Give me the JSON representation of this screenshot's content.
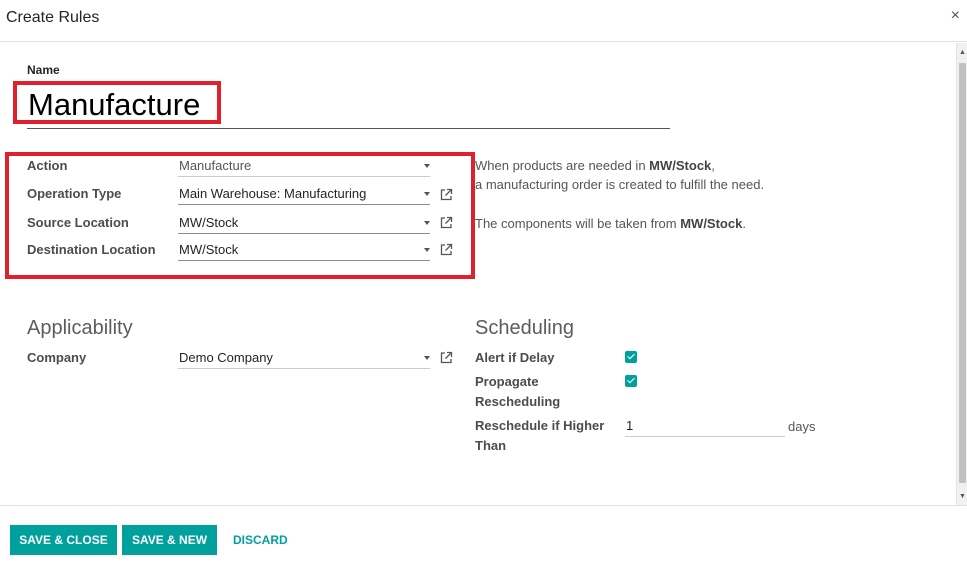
{
  "dialog": {
    "title": "Create Rules",
    "close_label": "×"
  },
  "name": {
    "label": "Name",
    "value": "Manufacture"
  },
  "fields": {
    "action": {
      "label": "Action",
      "value": "Manufacture"
    },
    "operation_type": {
      "label": "Operation Type",
      "value": "Main Warehouse: Manufacturing"
    },
    "source_location": {
      "label": "Source Location",
      "value": "MW/Stock"
    },
    "destination_location": {
      "label": "Destination Location",
      "value": "MW/Stock"
    }
  },
  "help": {
    "line1_pre": "When products are needed in ",
    "line1_bold": "MW/Stock",
    "line1_post": ",",
    "line2": "a manufacturing order is created to fulfill the need.",
    "line3_pre": "The components will be taken from ",
    "line3_bold": "MW/Stock",
    "line3_post": "."
  },
  "applicability": {
    "heading": "Applicability",
    "company_label": "Company",
    "company_value": "Demo Company"
  },
  "scheduling": {
    "heading": "Scheduling",
    "alert_if_delay_label": "Alert if Delay",
    "alert_if_delay_checked": true,
    "propagate_label_1": "Propagate",
    "propagate_label_2": "Rescheduling",
    "propagate_checked": true,
    "reschedule_label_1": "Reschedule if Higher",
    "reschedule_label_2": "Than",
    "reschedule_value": "1",
    "reschedule_unit": "days"
  },
  "footer": {
    "save_close": "SAVE & CLOSE",
    "save_new": "SAVE & NEW",
    "discard": "DISCARD"
  },
  "colors": {
    "accent": "#00a09d",
    "highlight": "#e0202a"
  }
}
